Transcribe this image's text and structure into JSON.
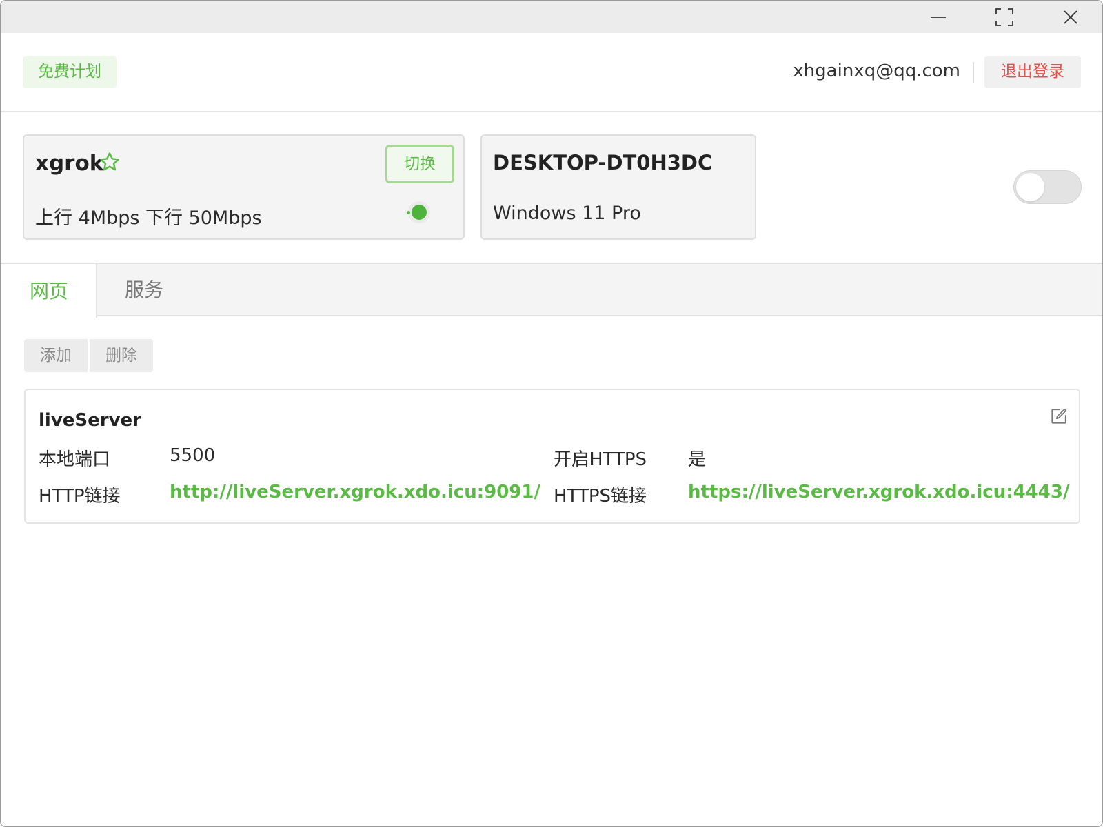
{
  "window": {
    "controls": {
      "minimize_icon": "minimize-icon",
      "maximize_icon": "maximize-icon",
      "close_icon": "close-icon"
    }
  },
  "header": {
    "plan": "免费计划",
    "email": "xhgainxq@qq.com",
    "logout_label": "退出登录"
  },
  "server": {
    "name": "xgrok",
    "favorite_icon": "star-outline-icon",
    "switch_label": "切换",
    "bandwidth": "上行 4Mbps 下行 50Mbps",
    "status": "online",
    "status_color": "#4db33a"
  },
  "device": {
    "name": "DESKTOP-DT0H3DC",
    "os": "Windows 11 Pro"
  },
  "power_toggle": {
    "on": false
  },
  "tabs": [
    {
      "label": "网页",
      "active": true
    },
    {
      "label": "服务",
      "active": false
    }
  ],
  "actions": {
    "add_label": "添加",
    "delete_label": "删除"
  },
  "tunnel": {
    "name": "liveServer",
    "local_port_label": "本地端口",
    "local_port": "5500",
    "https_enabled_label": "开启HTTPS",
    "https_enabled": "是",
    "http_link_label": "HTTP链接",
    "http_link": "http://liveServer.xgrok.xdo.icu:9091/",
    "https_link_label": "HTTPS链接",
    "https_link": "https://liveServer.xgrok.xdo.icu:4443/",
    "edit_icon": "edit-icon"
  },
  "colors": {
    "accent": "#5bb946",
    "danger": "#e8504a"
  }
}
